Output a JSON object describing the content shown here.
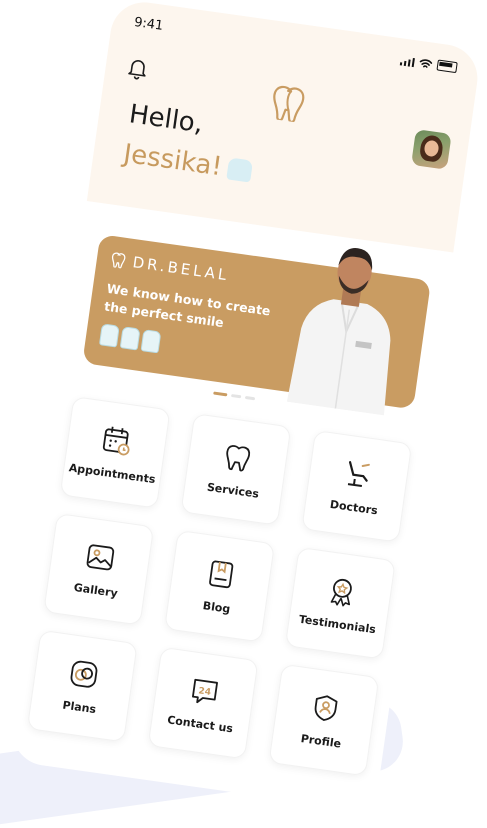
{
  "status": {
    "time": "9:41"
  },
  "greeting": {
    "hello": "Hello,",
    "name": "Jessika!"
  },
  "banner": {
    "brand": "DR.BELAL",
    "tagline": "We know how to create the perfect smile",
    "doctor_badge": "Dr.Belal"
  },
  "carousel": {
    "pages": 3,
    "active_index": 0
  },
  "menu": [
    {
      "label": "Appointments",
      "icon": "calendar-icon"
    },
    {
      "label": "Services",
      "icon": "tooth-icon"
    },
    {
      "label": "Doctors",
      "icon": "dental-chair-icon"
    },
    {
      "label": "Gallery",
      "icon": "image-icon"
    },
    {
      "label": "Blog",
      "icon": "bookmark-book-icon"
    },
    {
      "label": "Testimonials",
      "icon": "award-icon"
    },
    {
      "label": "Plans",
      "icon": "linked-circles-icon"
    },
    {
      "label": "Contact us",
      "icon": "24-hours-chat-icon"
    },
    {
      "label": "Profile",
      "icon": "user-shield-icon"
    }
  ],
  "colors": {
    "accent": "#c99c62",
    "header_bg": "#fdf6ee",
    "text": "#1b1b1b"
  }
}
